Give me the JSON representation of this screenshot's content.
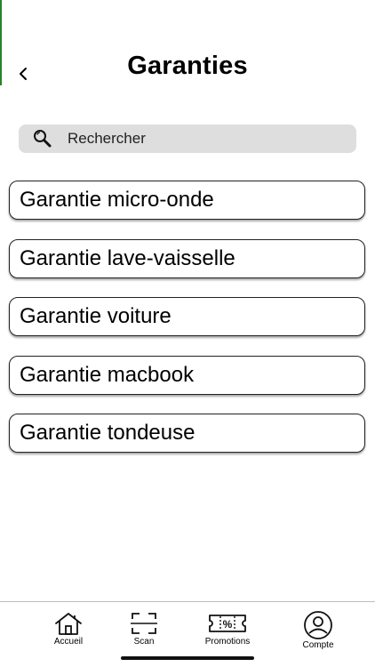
{
  "header": {
    "title": "Garanties",
    "back_icon": "chevron-left-icon"
  },
  "search": {
    "placeholder": "Rechercher",
    "icon": "search-icon"
  },
  "guarantees": [
    {
      "label": "Garantie micro-onde"
    },
    {
      "label": "Garantie lave-vaisselle"
    },
    {
      "label": "Garantie voiture"
    },
    {
      "label": "Garantie macbook"
    },
    {
      "label": "Garantie tondeuse"
    }
  ],
  "tabbar": {
    "tabs": [
      {
        "label": "Accueil",
        "icon": "home-icon"
      },
      {
        "label": "Scan",
        "icon": "scan-icon"
      },
      {
        "label": "Promotions",
        "icon": "promotion-ticket-icon"
      },
      {
        "label": "Compte",
        "icon": "account-icon"
      }
    ]
  },
  "colors": {
    "search_bg": "#dedede",
    "edge_accent": "#2e7d32"
  }
}
